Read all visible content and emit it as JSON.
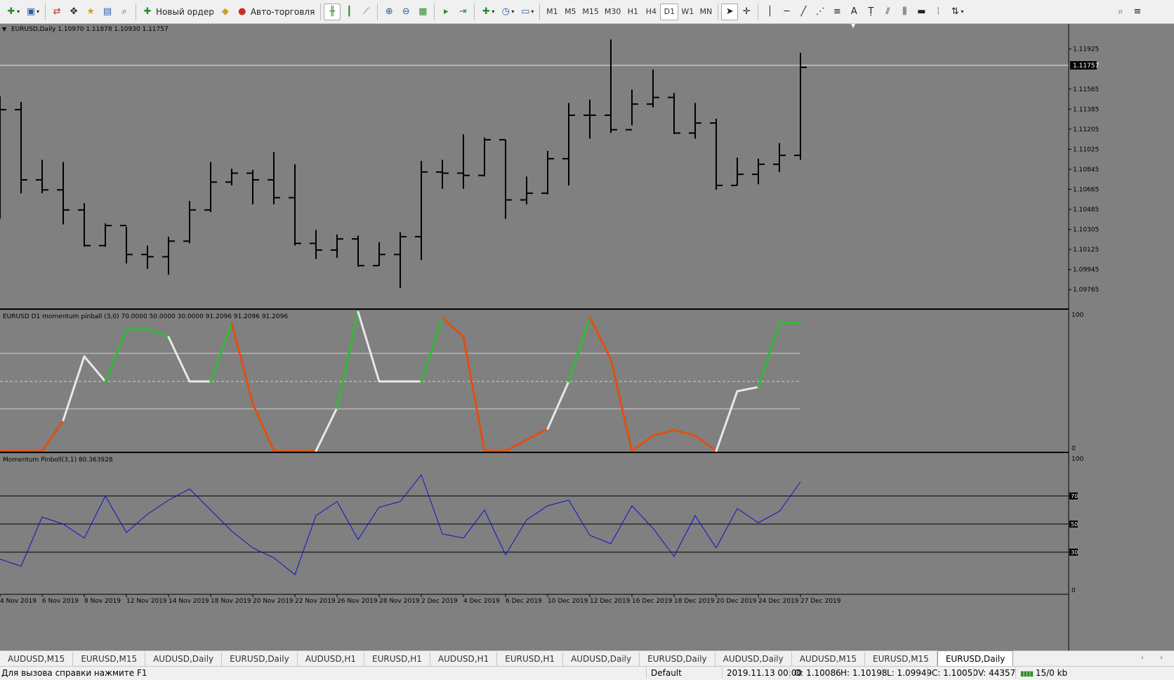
{
  "toolbar": {
    "new_order_label": "Новый ордер",
    "auto_trading_label": "Авто-торговля",
    "timeframes": [
      "M1",
      "M5",
      "M15",
      "M30",
      "H1",
      "H4",
      "D1",
      "W1",
      "MN"
    ],
    "active_timeframe": "D1"
  },
  "main_chart": {
    "header": "EURUSD,Daily  1.10970 1.11878 1.10930 1.11757",
    "current_price": "1.11757",
    "price_labels": [
      "1.11925",
      "1.11565",
      "1.11385",
      "1.11205",
      "1.11025",
      "1.10845",
      "1.10665",
      "1.10485",
      "1.10305",
      "1.10125",
      "1.09945",
      "1.09765"
    ]
  },
  "pinball_panel": {
    "header": "EURUSD D1 momentum pinball (3,0) 70.0000 50.0000 30.0000 91.2096 91.2096 91.2096",
    "scale_top": "100",
    "scale_bottom": "0"
  },
  "momentum_panel": {
    "header": "Momentum Pinboll(3,1) 80.363928",
    "scale_top": "100",
    "scale_70": "70",
    "scale_50": "50",
    "scale_30": "30",
    "scale_bottom": "0"
  },
  "date_labels": [
    "4 Nov 2019",
    "6 Nov 2019",
    "8 Nov 2019",
    "12 Nov 2019",
    "14 Nov 2019",
    "18 Nov 2019",
    "20 Nov 2019",
    "22 Nov 2019",
    "26 Nov 2019",
    "28 Nov 2019",
    "2 Dec 2019",
    "4 Dec 2019",
    "6 Dec 2019",
    "10 Dec 2019",
    "12 Dec 2019",
    "16 Dec 2019",
    "18 Dec 2019",
    "20 Dec 2019",
    "24 Dec 2019",
    "27 Dec 2019"
  ],
  "chart_data": {
    "type": "ohlc",
    "colors": {
      "background": "#808080",
      "bars": "#000000",
      "up": "#33bb33",
      "down": "#e05010",
      "neutral": "#e8e8e8",
      "momentum": "#1010cc"
    },
    "ylim": [
      1.09765,
      1.1205
    ],
    "bars": [
      {
        "o": 1.1138,
        "h": 1.115,
        "l": 1.104,
        "c": 1.1138
      },
      {
        "o": 1.1138,
        "h": 1.1145,
        "l": 1.1063,
        "c": 1.1075
      },
      {
        "o": 1.1075,
        "h": 1.1093,
        "l": 1.1063,
        "c": 1.1066
      },
      {
        "o": 1.1066,
        "h": 1.1091,
        "l": 1.1035,
        "c": 1.1048
      },
      {
        "o": 1.1048,
        "h": 1.1054,
        "l": 1.1015,
        "c": 1.1016
      },
      {
        "o": 1.1016,
        "h": 1.1036,
        "l": 1.1015,
        "c": 1.1034
      },
      {
        "o": 1.1034,
        "h": 1.1033,
        "l": 1.1,
        "c": 1.1008
      },
      {
        "o": 1.1008,
        "h": 1.1016,
        "l": 1.0995,
        "c": 1.1006
      },
      {
        "o": 1.1006,
        "h": 1.1024,
        "l": 1.099,
        "c": 1.102
      },
      {
        "o": 1.102,
        "h": 1.1056,
        "l": 1.1018,
        "c": 1.1048
      },
      {
        "o": 1.1048,
        "h": 1.1091,
        "l": 1.1046,
        "c": 1.1073
      },
      {
        "o": 1.1073,
        "h": 1.1085,
        "l": 1.107,
        "c": 1.1081
      },
      {
        "o": 1.1081,
        "h": 1.1084,
        "l": 1.1053,
        "c": 1.1075
      },
      {
        "o": 1.1075,
        "h": 1.11,
        "l": 1.1053,
        "c": 1.1059
      },
      {
        "o": 1.1059,
        "h": 1.1089,
        "l": 1.1016,
        "c": 1.1018
      },
      {
        "o": 1.1018,
        "h": 1.103,
        "l": 1.1004,
        "c": 1.1012
      },
      {
        "o": 1.1012,
        "h": 1.1026,
        "l": 1.1005,
        "c": 1.1022
      },
      {
        "o": 1.1022,
        "h": 1.1025,
        "l": 1.0997,
        "c": 1.0998
      },
      {
        "o": 1.0998,
        "h": 1.1019,
        "l": 1.0998,
        "c": 1.1008
      },
      {
        "o": 1.1008,
        "h": 1.1028,
        "l": 1.0978,
        "c": 1.1024
      },
      {
        "o": 1.1024,
        "h": 1.1092,
        "l": 1.1003,
        "c": 1.1082
      },
      {
        "o": 1.1082,
        "h": 1.1093,
        "l": 1.1067,
        "c": 1.1081
      },
      {
        "o": 1.1081,
        "h": 1.1116,
        "l": 1.1067,
        "c": 1.1079
      },
      {
        "o": 1.1079,
        "h": 1.1113,
        "l": 1.1078,
        "c": 1.1111
      },
      {
        "o": 1.1111,
        "h": 1.1111,
        "l": 1.104,
        "c": 1.1057
      },
      {
        "o": 1.1057,
        "h": 1.1078,
        "l": 1.1053,
        "c": 1.1063
      },
      {
        "o": 1.1063,
        "h": 1.1101,
        "l": 1.1062,
        "c": 1.1094
      },
      {
        "o": 1.1094,
        "h": 1.1144,
        "l": 1.107,
        "c": 1.1133
      },
      {
        "o": 1.1133,
        "h": 1.1147,
        "l": 1.1112,
        "c": 1.1133
      },
      {
        "o": 1.1133,
        "h": 1.1201,
        "l": 1.1117,
        "c": 1.112
      },
      {
        "o": 1.112,
        "h": 1.1156,
        "l": 1.1124,
        "c": 1.1143
      },
      {
        "o": 1.1143,
        "h": 1.1174,
        "l": 1.114,
        "c": 1.1149
      },
      {
        "o": 1.1149,
        "h": 1.1153,
        "l": 1.1116,
        "c": 1.1117
      },
      {
        "o": 1.1117,
        "h": 1.1144,
        "l": 1.1112,
        "c": 1.1126
      },
      {
        "o": 1.1126,
        "h": 1.113,
        "l": 1.1066,
        "c": 1.107
      },
      {
        "o": 1.107,
        "h": 1.1095,
        "l": 1.107,
        "c": 1.108
      },
      {
        "o": 1.108,
        "h": 1.1094,
        "l": 1.1071,
        "c": 1.1089
      },
      {
        "o": 1.1089,
        "h": 1.1108,
        "l": 1.1082,
        "c": 1.1097
      },
      {
        "o": 1.1097,
        "h": 1.1189,
        "l": 1.1093,
        "c": 1.1176
      }
    ],
    "pinball": [
      0,
      0,
      0,
      22,
      68,
      50,
      87,
      88,
      82,
      50,
      50,
      92,
      34,
      0,
      0,
      0,
      31,
      100,
      50,
      50,
      50,
      96,
      82,
      0,
      0,
      8,
      16,
      50,
      96,
      66,
      0,
      11,
      15,
      11,
      0,
      43,
      46,
      92,
      92
    ],
    "pinball_colors": [
      "down",
      "down",
      "down",
      "down",
      "neutral",
      "neutral",
      "up",
      "up",
      "up",
      "neutral",
      "neutral",
      "up",
      "down",
      "down",
      "down",
      "down",
      "neutral",
      "up",
      "neutral",
      "neutral",
      "neutral",
      "up",
      "down",
      "down",
      "down",
      "down",
      "down",
      "neutral",
      "up",
      "down",
      "down",
      "down",
      "down",
      "down",
      "down",
      "neutral",
      "neutral",
      "up",
      "up"
    ],
    "momentum": [
      25,
      20,
      55,
      50,
      40,
      70,
      44,
      57,
      67,
      75,
      60,
      45,
      33,
      26,
      14,
      56,
      66,
      39,
      62,
      66,
      85,
      43,
      40,
      60,
      28,
      53,
      63,
      67,
      42,
      36,
      63,
      47,
      27,
      56,
      33,
      61,
      51,
      59,
      80
    ]
  },
  "tabs": [
    "AUDUSD,M15",
    "EURUSD,M15",
    "AUDUSD,Daily",
    "EURUSD,Daily",
    "AUDUSD,H1",
    "EURUSD,H1",
    "AUDUSD,H1",
    "EURUSD,H1",
    "AUDUSD,Daily",
    "EURUSD,Daily",
    "AUDUSD,Daily",
    "AUDUSD,M15",
    "EURUSD,M15",
    "EURUSD,Daily"
  ],
  "active_tab": 13,
  "status": {
    "help": "Для вызова справки нажмите F1",
    "profile": "Default",
    "datetime": "2019.11.13 00:00",
    "open": "O: 1.10086",
    "high": "H: 1.10198",
    "low": "L: 1.09949",
    "close": "C: 1.10050",
    "volume": "V: 44357",
    "traffic": "15/0 kb"
  }
}
